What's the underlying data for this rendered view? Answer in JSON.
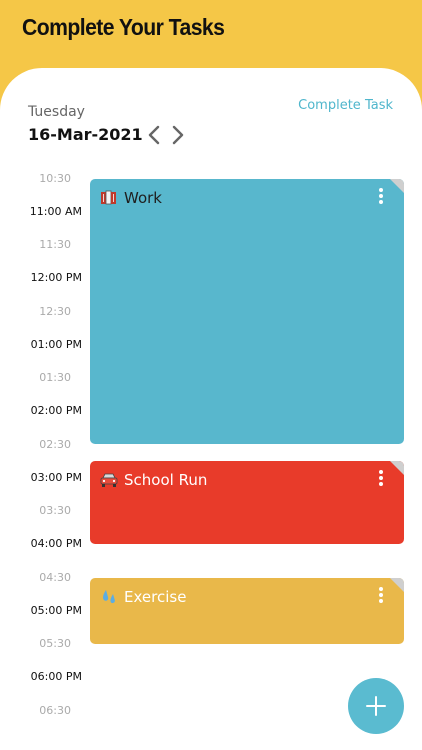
{
  "header": {
    "title": "Complete Your Tasks"
  },
  "date_bar": {
    "day": "Tuesday",
    "date": "16-Mar-2021",
    "complete_task_label": "Complete Task"
  },
  "timeline": [
    {
      "label": "10:30",
      "major": false
    },
    {
      "label": "11:00 AM",
      "major": true
    },
    {
      "label": "11:30",
      "major": false
    },
    {
      "label": "12:00 PM",
      "major": true
    },
    {
      "label": "12:30",
      "major": false
    },
    {
      "label": "01:00 PM",
      "major": true
    },
    {
      "label": "01:30",
      "major": false
    },
    {
      "label": "02:00 PM",
      "major": true
    },
    {
      "label": "02:30",
      "major": false
    },
    {
      "label": "03:00 PM",
      "major": true
    },
    {
      "label": "03:30",
      "major": false
    },
    {
      "label": "04:00 PM",
      "major": true
    },
    {
      "label": "04:30",
      "major": false
    },
    {
      "label": "05:00 PM",
      "major": true
    },
    {
      "label": "05:30",
      "major": false
    },
    {
      "label": "06:00 PM",
      "major": true
    },
    {
      "label": "06:30",
      "major": false
    }
  ],
  "events": [
    {
      "title": "Work",
      "icon": "books-icon",
      "color": "#58B7CD",
      "text_color": "#1f1f1f"
    },
    {
      "title": "School Run",
      "icon": "car-icon",
      "color": "#E83B2A",
      "text_color": "#ffffff"
    },
    {
      "title": "Exercise",
      "icon": "sweat-drops-icon",
      "color": "#E9B84A",
      "text_color": "#ffffff"
    }
  ],
  "fab": {
    "icon": "plus-icon",
    "color": "#5ABBD0"
  }
}
